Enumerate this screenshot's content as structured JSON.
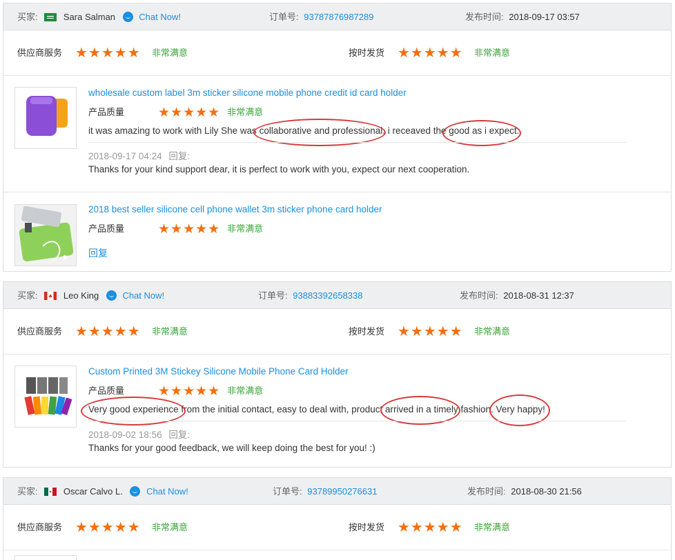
{
  "labels": {
    "buyer": "买家:",
    "order_no": "订单号:",
    "post_time": "发布时间:",
    "supplier_service": "供应商服务",
    "on_time_delivery": "按时发货",
    "product_quality": "产品质量",
    "reply": "回复:",
    "reply_link": "回复",
    "chat_now": "Chat Now!",
    "very_satisfied": "非常满意"
  },
  "ratings": {
    "stars": "★★★★★",
    "scale_max": 5
  },
  "colors": {
    "accent": "#1a8fe0",
    "star": "#f66e0d",
    "satisfied": "#3ba63b",
    "annotation": "#d63a3a"
  },
  "reviews": [
    {
      "buyer": "Sara Salman",
      "flag": "saudi-arabia-flag",
      "order_no": "93787876987289",
      "post_time": "2018-09-17 03:57",
      "supplier_service_stars": 5,
      "on_time_stars": 5,
      "products": [
        {
          "title": "wholesale custom label 3m sticker silicone mobile phone credit id card holder",
          "quality_stars": 5,
          "comment": "it was amazing to work with Lily She was collaborative and professional, i receaved the good as i expect.",
          "comment_time": "2018-09-17 04:24",
          "reply": "Thanks for your kind support dear, it is perfect to work with you, expect our next cooperation."
        },
        {
          "title": "2018 best seller silicone cell phone wallet 3m sticker phone card holder",
          "quality_stars": 5
        }
      ]
    },
    {
      "buyer": "Leo King",
      "flag": "canada-flag",
      "order_no": "93883392658338",
      "post_time": "2018-08-31 12:37",
      "supplier_service_stars": 5,
      "on_time_stars": 5,
      "products": [
        {
          "title": "Custom Printed 3M Stickey Silicone Mobile Phone Card Holder",
          "quality_stars": 5,
          "comment": "Very good experience from the initial contact, easy to deal with, product arrived in a timely fashion. Very happy!",
          "comment_time": "2018-09-02 18:56",
          "reply": "Thanks for your good feedback, we will keep doing the best for you! :)"
        }
      ]
    },
    {
      "buyer": "Oscar Calvo L.",
      "flag": "mexico-flag",
      "order_no": "93789950276631",
      "post_time": "2018-08-30 21:56",
      "supplier_service_stars": 5,
      "on_time_stars": 5
    }
  ]
}
